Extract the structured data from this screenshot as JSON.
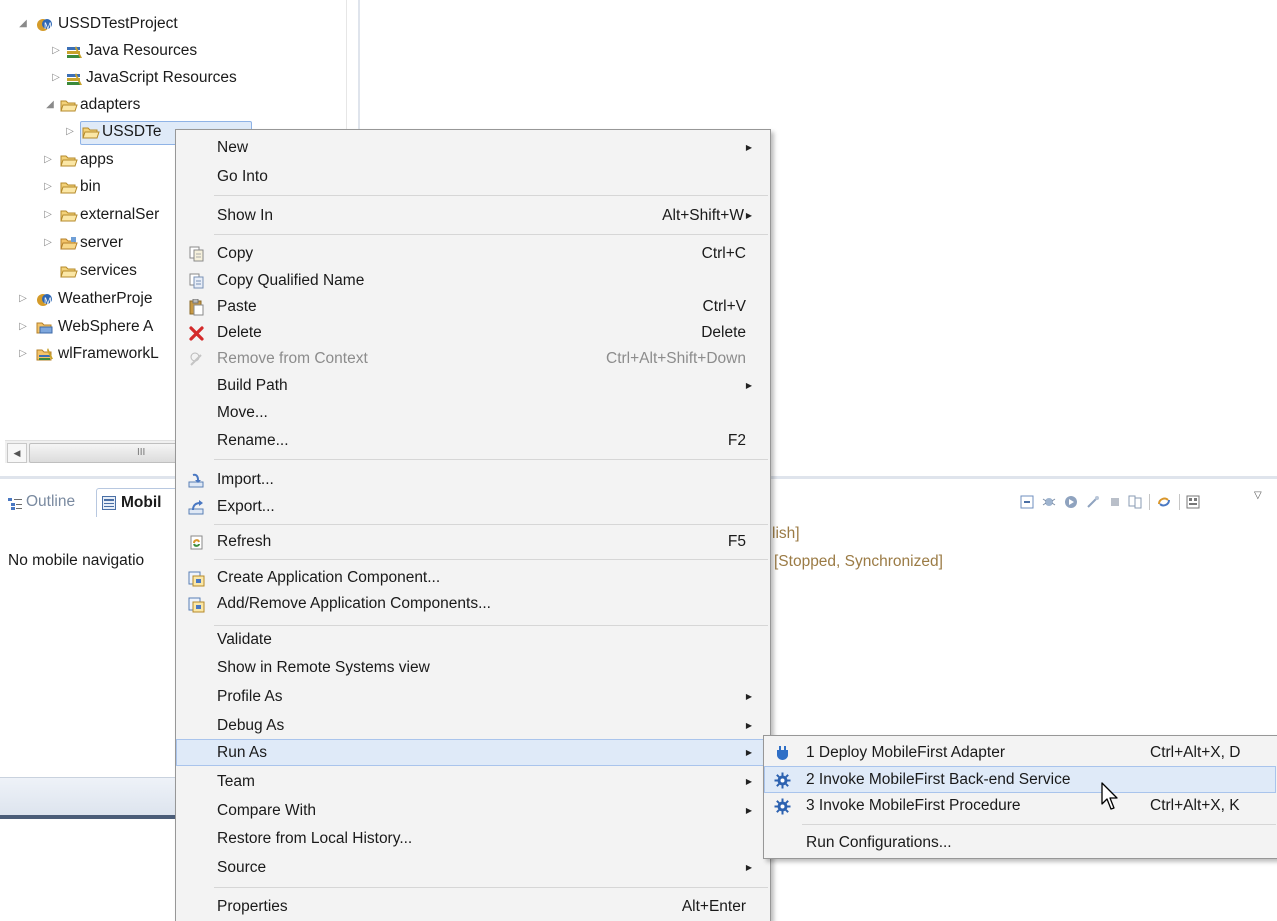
{
  "tree": {
    "root": "USSDTestProject",
    "items": [
      {
        "label": "Java Resources"
      },
      {
        "label": "JavaScript Resources"
      },
      {
        "label": "adapters"
      },
      {
        "label": "USSDTe"
      },
      {
        "label": "apps"
      },
      {
        "label": "bin"
      },
      {
        "label": "externalSer"
      },
      {
        "label": "server"
      },
      {
        "label": "services"
      },
      {
        "label": "WeatherProje"
      },
      {
        "label": "WebSphere A"
      },
      {
        "label": "wlFrameworkL"
      }
    ]
  },
  "scrollbar": {
    "thumb_glyph": "III"
  },
  "bottom_panel": {
    "tabs": [
      {
        "label": "Outline"
      },
      {
        "label": "Mobil"
      }
    ],
    "message": "No mobile navigatio",
    "server_line1": "lish]",
    "server_line2": "[Stopped, Synchronized]"
  },
  "context_menu": {
    "items": [
      {
        "label": "New",
        "shortcut": "",
        "submenu": true
      },
      {
        "label": "Go Into",
        "shortcut": ""
      },
      {
        "label": "Show In",
        "shortcut": "Alt+Shift+W",
        "submenu": true
      },
      {
        "label": "Copy",
        "shortcut": "Ctrl+C",
        "icon": "copy-icon"
      },
      {
        "label": "Copy Qualified Name",
        "shortcut": "",
        "icon": "copy-qualified-name-icon"
      },
      {
        "label": "Paste",
        "shortcut": "Ctrl+V",
        "icon": "paste-icon"
      },
      {
        "label": "Delete",
        "shortcut": "Delete",
        "icon": "delete-icon"
      },
      {
        "label": "Remove from Context",
        "shortcut": "Ctrl+Alt+Shift+Down",
        "icon": "remove-from-context-icon",
        "disabled": true
      },
      {
        "label": "Build Path",
        "shortcut": "",
        "submenu": true
      },
      {
        "label": "Move...",
        "shortcut": ""
      },
      {
        "label": "Rename...",
        "shortcut": "F2"
      },
      {
        "label": "Import...",
        "shortcut": "",
        "icon": "import-icon"
      },
      {
        "label": "Export...",
        "shortcut": "",
        "icon": "export-icon"
      },
      {
        "label": "Refresh",
        "shortcut": "F5",
        "icon": "refresh-icon"
      },
      {
        "label": "Create Application Component...",
        "shortcut": "",
        "icon": "create-component-icon"
      },
      {
        "label": "Add/Remove Application Components...",
        "shortcut": "",
        "icon": "add-remove-components-icon"
      },
      {
        "label": "Validate",
        "shortcut": ""
      },
      {
        "label": "Show in Remote Systems view",
        "shortcut": ""
      },
      {
        "label": "Profile As",
        "shortcut": "",
        "submenu": true
      },
      {
        "label": "Debug As",
        "shortcut": "",
        "submenu": true
      },
      {
        "label": "Run As",
        "shortcut": "",
        "submenu": true,
        "highlighted": true
      },
      {
        "label": "Team",
        "shortcut": "",
        "submenu": true
      },
      {
        "label": "Compare With",
        "shortcut": "",
        "submenu": true
      },
      {
        "label": "Restore from Local History...",
        "shortcut": ""
      },
      {
        "label": "Source",
        "shortcut": "",
        "submenu": true
      },
      {
        "label": "Properties",
        "shortcut": "Alt+Enter"
      }
    ]
  },
  "run_as_submenu": {
    "items": [
      {
        "label": "1 Deploy MobileFirst Adapter",
        "shortcut": "Ctrl+Alt+X, D",
        "icon": "deploy-adapter-icon"
      },
      {
        "label": "2 Invoke MobileFirst Back-end Service",
        "shortcut": "",
        "icon": "gear-icon",
        "highlighted": true
      },
      {
        "label": "3 Invoke MobileFirst Procedure",
        "shortcut": "Ctrl+Alt+X, K",
        "icon": "gear-icon"
      },
      {
        "label": "Run Configurations...",
        "shortcut": ""
      }
    ]
  },
  "colors": {
    "menu_bg": "#f3f3f3",
    "highlight_bg": "#dfeaf8",
    "highlight_border": "#a9c4ec",
    "server_text": "#9b7b45",
    "tab_inactive_text": "#7a8aa0"
  }
}
